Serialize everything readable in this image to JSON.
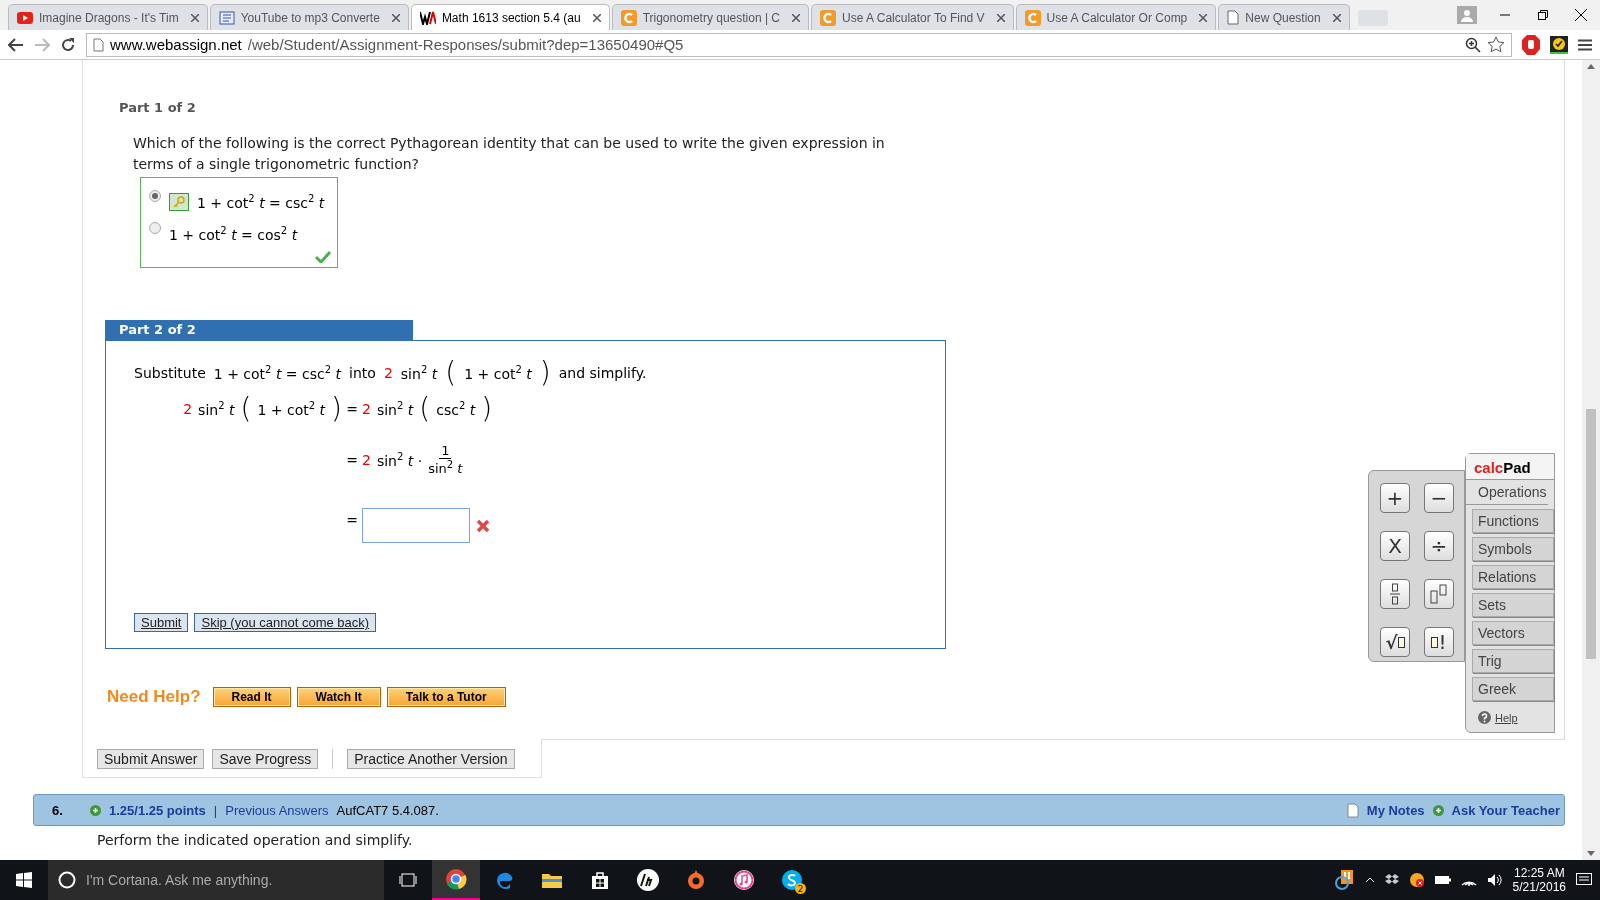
{
  "browser": {
    "tabs": [
      {
        "title": "Imagine Dragons - It's Tim",
        "kind": "video",
        "selected": false
      },
      {
        "title": "YouTube to mp3 Converte",
        "kind": "mp3",
        "selected": false
      },
      {
        "title": "Math 1613 section 5.4 (au",
        "kind": "wa",
        "selected": true
      },
      {
        "title": "Trigonometry question | C",
        "kind": "c",
        "selected": false
      },
      {
        "title": "Use A Calculator To Find V",
        "kind": "c",
        "selected": false
      },
      {
        "title": "Use A Calculator Or Comp",
        "kind": "c",
        "selected": false
      },
      {
        "title": "New Question",
        "kind": "page",
        "selected": false
      }
    ],
    "url_host": "www.webassign.net",
    "url_path": "/web/Student/Assignment-Responses/submit?dep=13650490#Q5"
  },
  "part1": {
    "label": "Part 1 of 2",
    "question": "Which of the following is the correct Pythagorean identity that can be used to write the given expression in terms of a single trigonometric function?",
    "correct": true,
    "options": [
      {
        "math": "1 + cot$^{2}$ *t* = csc$^{2}$ *t*",
        "selected": true,
        "key": true
      },
      {
        "math": "1 + cot$^{2}$ *t* = cos$^{2}$ *t*",
        "selected": false,
        "key": false
      }
    ]
  },
  "part2": {
    "label": "Part 2 of 2",
    "prompt": [
      {
        "kind": "text",
        "text": "Substitute"
      },
      {
        "kind": "math",
        "text": "1 + cot$^{2}$ *t* = csc$^{2}$ *t*"
      },
      {
        "kind": "text",
        "text": "into"
      },
      {
        "kind": "coef",
        "text": "2"
      },
      {
        "kind": "math",
        "text": "sin$^{2}$ *t*"
      },
      {
        "kind": "paren",
        "text": "("
      },
      {
        "kind": "math",
        "text": "1 + cot$^{2}$ *t*"
      },
      {
        "kind": "paren",
        "text": ")"
      },
      {
        "kind": "text",
        "text": "and simplify."
      }
    ],
    "steps": [
      {
        "kind": "expr",
        "lhs": [
          {
            "kind": "coef",
            "text": "2"
          },
          {
            "kind": "math",
            "text": "sin$^{2}$ *t*"
          },
          {
            "kind": "paren",
            "text": "("
          },
          {
            "kind": "math",
            "text": "1 + cot$^{2}$ *t*"
          },
          {
            "kind": "paren",
            "text": ")"
          }
        ],
        "eq": "=",
        "rhs": [
          {
            "kind": "coef",
            "text": "2"
          },
          {
            "kind": "math",
            "text": "sin$^{2}$ *t*"
          },
          {
            "kind": "paren",
            "text": "("
          },
          {
            "kind": "math",
            "text": "csc$^{2}$ *t*"
          },
          {
            "kind": "paren",
            "text": ")"
          }
        ]
      },
      {
        "kind": "expr",
        "eq": "=",
        "rhs": [
          {
            "kind": "coef",
            "text": "2"
          },
          {
            "kind": "math",
            "text": "sin$^{2}$ *t* ·"
          },
          {
            "kind": "frac",
            "num": "1",
            "den": "sin$^{2}$ *t*"
          }
        ]
      },
      {
        "kind": "answer",
        "eq": "=",
        "correct": false
      }
    ],
    "buttons": [
      "Submit",
      "Skip (you cannot come back)"
    ]
  },
  "help": {
    "label": "Need Help?",
    "buttons": [
      "Read It",
      "Watch It",
      "Talk to a Tutor"
    ]
  },
  "actions": [
    "Submit Answer",
    "Save Progress",
    "Practice Another Version"
  ],
  "next_question": {
    "number": "6.",
    "points": "1.25/1.25 points",
    "separator": "|",
    "previous": "Previous Answers",
    "code": "AufCAT7 5.4.087.",
    "notes": "My Notes",
    "ask": "Ask Your Teacher",
    "text": "Perform the indicated operation and simplify."
  },
  "calcpad": {
    "title_a": "calc",
    "title_b": "Pad",
    "keys": [
      {
        "kind": "glyph",
        "text": "+"
      },
      {
        "kind": "glyph",
        "text": "−"
      },
      {
        "kind": "glyph",
        "text": "X"
      },
      {
        "kind": "glyph",
        "text": "÷"
      },
      {
        "kind": "fraction"
      },
      {
        "kind": "power"
      },
      {
        "kind": "sqrt",
        "text": "√"
      },
      {
        "kind": "factorial",
        "text": "!"
      }
    ],
    "tabs": [
      {
        "label": "Operations",
        "selected": true
      },
      {
        "label": "Functions",
        "selected": false
      },
      {
        "label": "Symbols",
        "selected": false
      },
      {
        "label": "Relations",
        "selected": false
      },
      {
        "label": "Sets",
        "selected": false
      },
      {
        "label": "Vectors",
        "selected": false
      },
      {
        "label": "Trig",
        "selected": false
      },
      {
        "label": "Greek",
        "selected": false
      }
    ],
    "help": "Help"
  },
  "taskbar": {
    "search_placeholder": "I'm Cortana. Ask me anything.",
    "skype_badge": "2",
    "time": "12:25 AM",
    "date": "5/21/2016"
  }
}
